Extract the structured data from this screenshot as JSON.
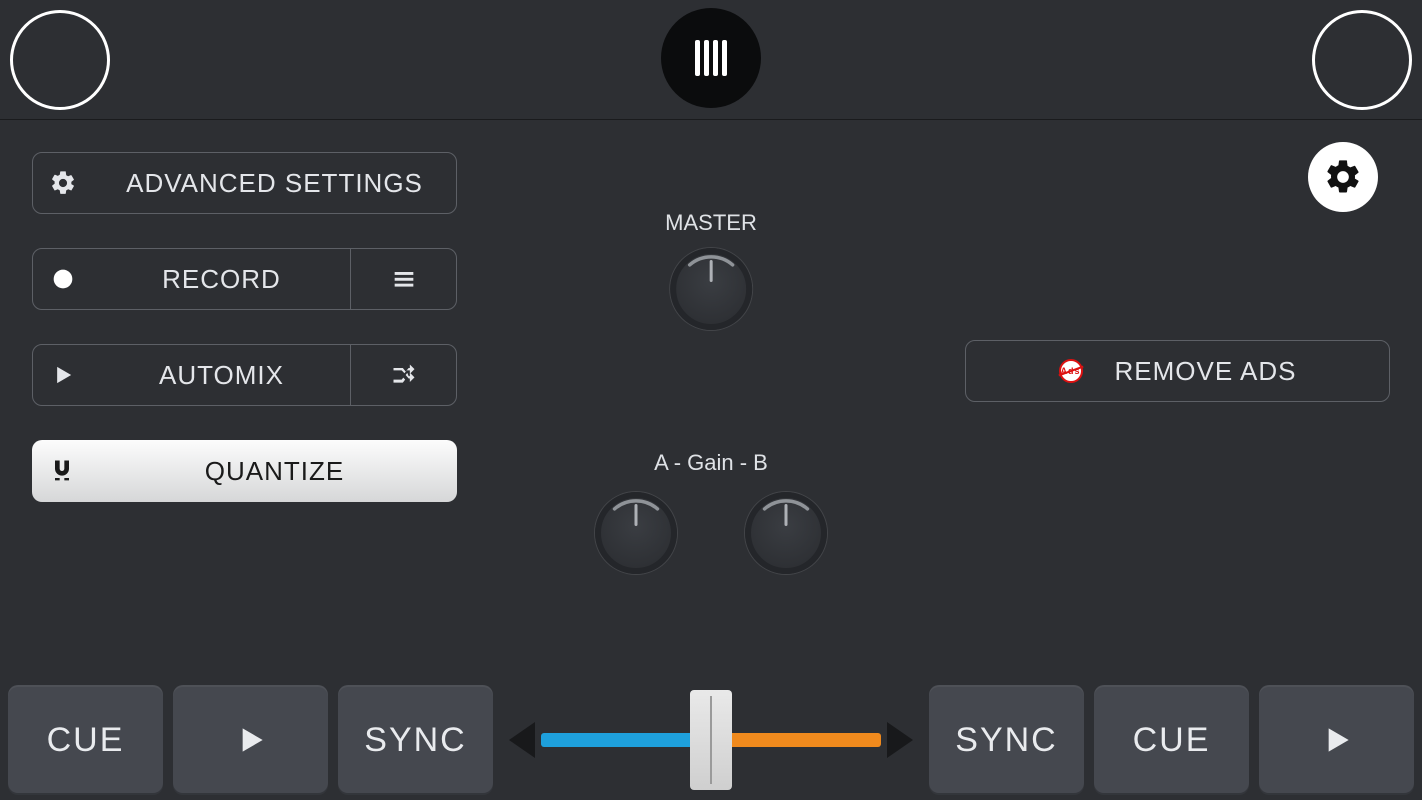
{
  "sidebar": {
    "advanced_settings": "ADVANCED SETTINGS",
    "record": "RECORD",
    "automix": "AUTOMIX",
    "quantize": "QUANTIZE"
  },
  "center": {
    "master_label": "MASTER",
    "gain_label": "A -  Gain  - B"
  },
  "right": {
    "remove_ads": "REMOVE ADS",
    "ads_badge_text": "Ads"
  },
  "transport": {
    "cue_a": "CUE",
    "sync_a": "SYNC",
    "sync_b": "SYNC",
    "cue_b": "CUE"
  },
  "crossfader": {
    "position_percent": 50
  }
}
